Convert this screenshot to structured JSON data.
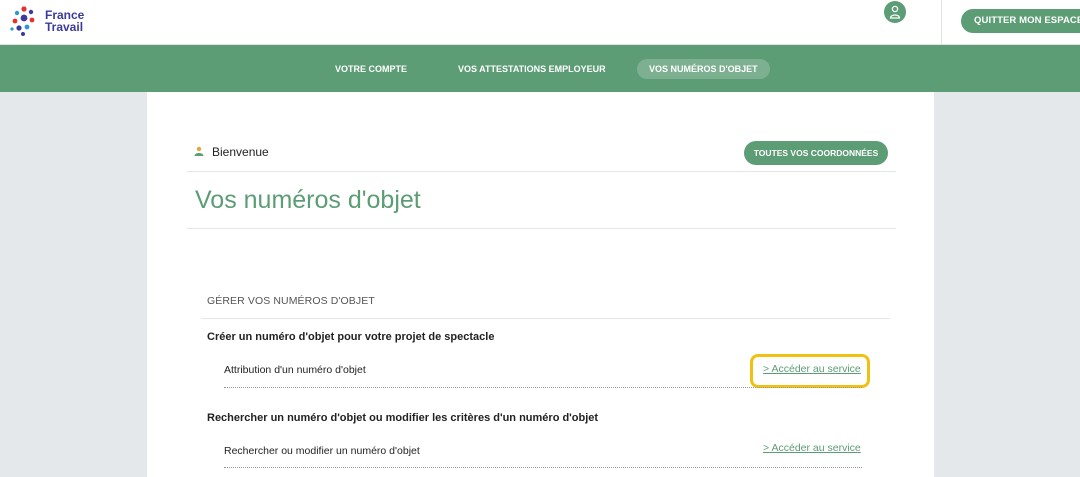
{
  "header": {
    "logo_line1": "France",
    "logo_line2": "Travail",
    "quit_label": "QUITTER MON ESPACE",
    "user_icon": "user-icon"
  },
  "nav": {
    "items": [
      {
        "label": "VOTRE COMPTE"
      },
      {
        "label": "VOS ATTESTATIONS EMPLOYEUR"
      },
      {
        "label": "VOS NUMÉROS D'OBJET"
      }
    ],
    "active_index": 2
  },
  "main": {
    "welcome": "Bienvenue",
    "coords_button": "TOUTES VOS COORDONNÉES",
    "page_title": "Vos numéros d'objet",
    "section_title": "GÉRER VOS NUMÉROS D'OBJET",
    "groups": [
      {
        "title": "Créer un numéro d'objet pour votre projet de spectacle",
        "item_label": "Attribution d'un numéro d'objet",
        "link": "> Accéder au service"
      },
      {
        "title": "Rechercher un numéro d'objet ou modifier les critères d'un numéro d'objet",
        "item_label": "Rechercher ou modifier un numéro d'objet",
        "link": "> Accéder au service"
      }
    ]
  },
  "colors": {
    "brand_green": "#5c9d75",
    "highlight": "#f2c10f",
    "logo_blue": "#3b3b9a"
  }
}
